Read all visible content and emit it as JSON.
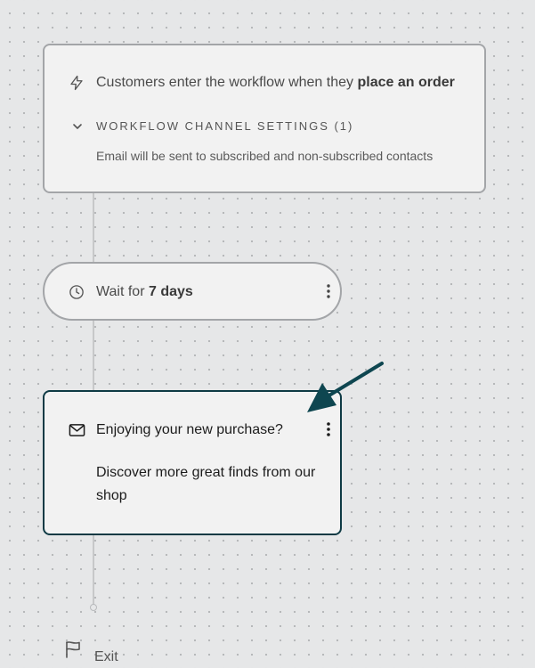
{
  "trigger": {
    "text_prefix": "Customers enter the workflow when they ",
    "text_bold": "place an order",
    "channel_settings_label": "WORKFLOW CHANNEL SETTINGS (1)",
    "channel_settings_description": "Email will be sent to subscribed and non-subscribed contacts",
    "icon": "lightning-icon"
  },
  "wait_step": {
    "text_prefix": "Wait for ",
    "text_bold": "7 days",
    "icon": "clock-icon"
  },
  "email_step": {
    "subject": "Enjoying your new purchase?",
    "preview": "Discover more great finds from our shop",
    "icon": "envelope-icon"
  },
  "exit": {
    "label": "Exit",
    "icon": "flag-icon"
  },
  "colors": {
    "canvas_background": "#e6e7e8",
    "card_background": "#f2f2f2",
    "card_border": "#a3a5a8",
    "selected_border": "#0e3a44",
    "annotation_arrow": "#0e4650"
  }
}
